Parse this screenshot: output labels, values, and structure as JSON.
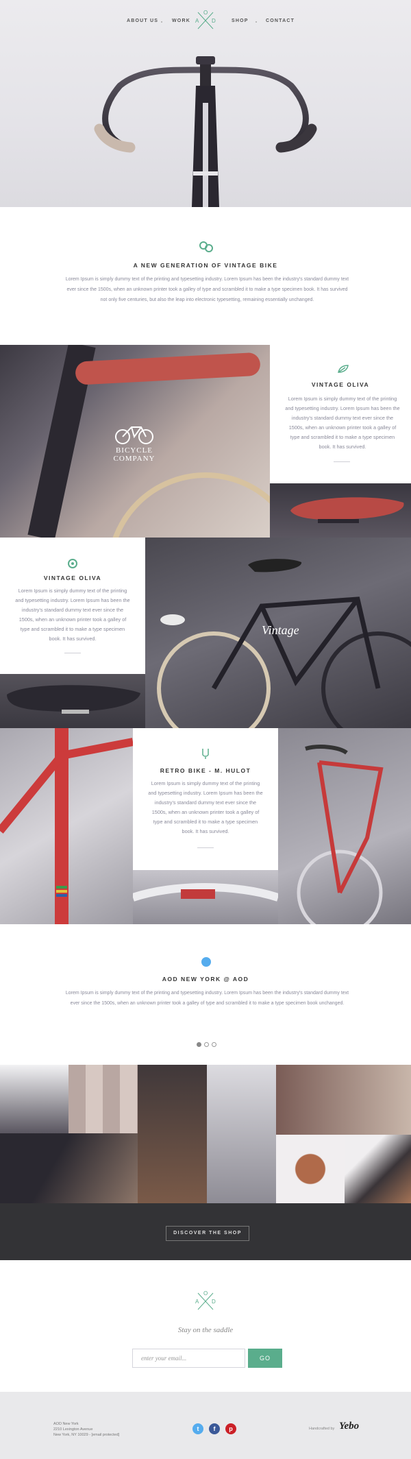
{
  "nav": {
    "items": [
      "ABOUT US",
      "WORK",
      "SHOP",
      "CONTACT"
    ],
    "logo": {
      "top": "O",
      "left": "A",
      "right": "D"
    }
  },
  "intro": {
    "title": "A NEW GENERATION OF VINTAGE BIKE",
    "body": "Lorem Ipsum is simply dummy text of the printing and typesetting industry. Lorem Ipsum has been the industry's standard dummy text ever since the 1500s, when an unknown printer took a galley of type and scrambled it to make a type specimen book. It has survived not only five centuries, but also the leap into electronic typesetting, remaining essentially unchanged."
  },
  "cards": [
    {
      "title": "VINTAGE OLIVA",
      "body": "Lorem Ipsum is simply dummy text of the printing and typesetting industry. Lorem Ipsum has been the industry's standard dummy text ever since the 1500s, when an unknown printer took a galley of type and scrambled it to make a type specimen book. It has survived."
    },
    {
      "title": "VINTAGE OLIVA",
      "body": "Lorem Ipsum is simply dummy text of the printing and typesetting industry. Lorem Ipsum has been the industry's standard dummy text ever since the 1500s, when an unknown printer took a galley of type and scrambled it to make a type specimen book. It has survived."
    },
    {
      "title": "RETRO BIKE - M. HULOT",
      "body": "Lorem Ipsum is simply dummy text of the printing and typesetting industry. Lorem Ipsum has been the industry's standard dummy text ever since the 1500s, when an unknown printer took a galley of type and scrambled it to make a type specimen book. It has survived."
    }
  ],
  "image_text": {
    "bicycle_company": "BICYCLE",
    "bicycle_company2": "COMPANY",
    "vintage": "Vintage"
  },
  "twitter": {
    "title": "AOD NEW YORK @ AOD",
    "body": "Lorem Ipsum is simply dummy text of the printing and typesetting industry. Lorem Ipsum has been the industry's standard dummy text ever since the 1500s, when an unknown printer took a galley of type and scrambled it to make a type specimen book unchanged."
  },
  "shop": {
    "button": "DISCOVER THE SHOP"
  },
  "newsletter": {
    "tagline": "Stay on the saddle",
    "placeholder": "enter your email...",
    "go": "GO"
  },
  "footer": {
    "address_lines": [
      "AOD New York",
      "2210 Lexington Avenue",
      "New York, NY 10029 - [email protected]"
    ],
    "credit": "Handcrafted by",
    "credit_brand": "Yebo"
  },
  "colors": {
    "accent": "#5aad8c",
    "twitter": "#55acee",
    "facebook": "#3b5998",
    "pinterest": "#cb2027",
    "dark": "#333333"
  }
}
